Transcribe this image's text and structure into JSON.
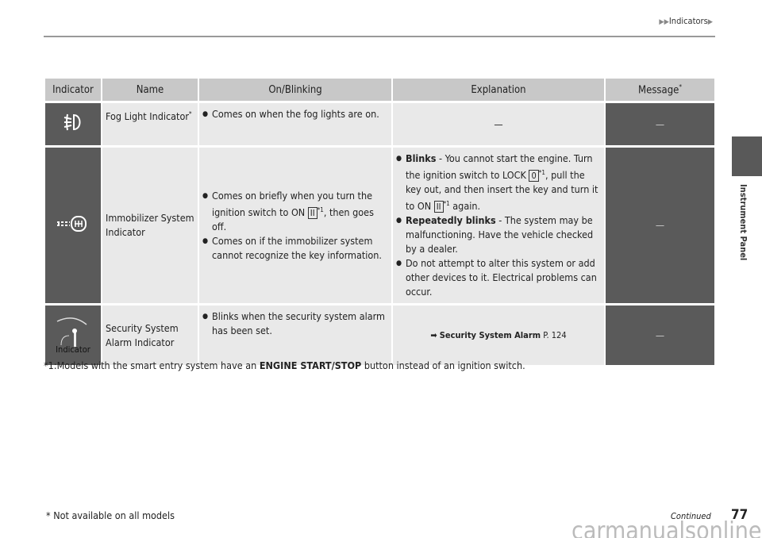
{
  "header": {
    "breadcrumb": "Indicators"
  },
  "sidebar": {
    "section": "Instrument Panel"
  },
  "table": {
    "headers": [
      "Indicator",
      "Name",
      "On/Blinking",
      "Explanation",
      "Message"
    ],
    "header_footnote": "*",
    "rows": [
      {
        "icon": "fog-light-icon",
        "name": "Fog Light Indicator",
        "name_mark": "*",
        "on": [
          "Comes on when the fog lights are on."
        ],
        "explanation": "—",
        "message": "—"
      },
      {
        "icon": "immobilizer-icon",
        "name": "Immobilizer System Indicator",
        "on_a1": "Comes on briefly when you turn the ignition switch to ON ",
        "on_key": "II",
        "on_a2": ", then goes off.",
        "on_b": "Comes on if the immobilizer system cannot recognize the key information.",
        "exp1_bold": "Blinks",
        "exp1a": " - You cannot start the engine. Turn the ignition switch to LOCK ",
        "exp1_key": "0",
        "exp1b": ", pull the key out, and then insert the key and turn it to ON ",
        "exp1_key2": "II",
        "exp1c": " again.",
        "exp2_bold": "Repeatedly blinks",
        "exp2": " - The system may be malfunctioning. Have the vehicle checked by a dealer.",
        "exp3": "Do not attempt to alter this system or add other devices to it. Electrical problems can occur.",
        "message": "—",
        "sup": "*1"
      },
      {
        "icon": "security-alarm-icon",
        "icon_label": "Indicator",
        "name": "Security System Alarm Indicator",
        "on": [
          "Blinks when the security system alarm has been set."
        ],
        "ref_bold": "Security System Alarm",
        "ref_page": " P. 124",
        "message": "—"
      }
    ]
  },
  "footnote": {
    "a": "*1:Models with the smart entry system have an ",
    "bold": "ENGINE START/STOP",
    "b": " button instead of an ignition switch."
  },
  "footer": {
    "note": "* Not available on all models",
    "continued": "Continued",
    "page": "77",
    "watermark": "carmanualsonline.info"
  }
}
